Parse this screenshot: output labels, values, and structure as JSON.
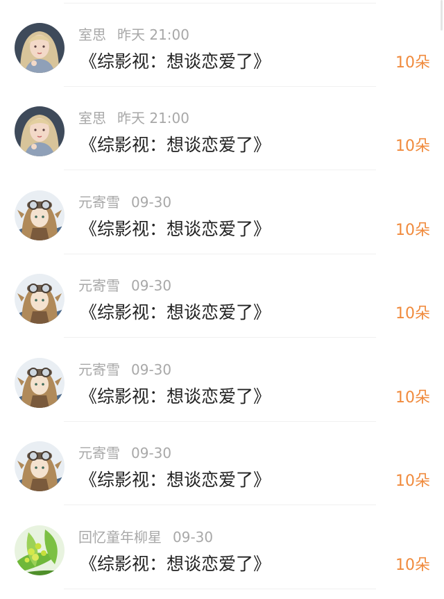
{
  "gift_records": [
    {
      "user": "室思",
      "time": "昨天 21:00",
      "title": "《综影视：想谈恋爱了》",
      "amount": "10朵",
      "avatar": "girl-portrait"
    },
    {
      "user": "室思",
      "time": "昨天 21:00",
      "title": "《综影视：想谈恋爱了》",
      "amount": "10朵",
      "avatar": "girl-portrait"
    },
    {
      "user": "元寄雪",
      "time": "09-30",
      "title": "《综影视：想谈恋爱了》",
      "amount": "10朵",
      "avatar": "goggles-character"
    },
    {
      "user": "元寄雪",
      "time": "09-30",
      "title": "《综影视：想谈恋爱了》",
      "amount": "10朵",
      "avatar": "goggles-character"
    },
    {
      "user": "元寄雪",
      "time": "09-30",
      "title": "《综影视：想谈恋爱了》",
      "amount": "10朵",
      "avatar": "goggles-character"
    },
    {
      "user": "元寄雪",
      "time": "09-30",
      "title": "《综影视：想谈恋爱了》",
      "amount": "10朵",
      "avatar": "goggles-character"
    },
    {
      "user": "回忆童年柳星",
      "time": "09-30",
      "title": "《综影视：想谈恋爱了》",
      "amount": "10朵",
      "avatar": "green-leaves"
    }
  ],
  "colors": {
    "amount": "#f08a3c",
    "meta": "#a8a8a8",
    "title": "#222222",
    "divider": "#f0f0f0"
  }
}
